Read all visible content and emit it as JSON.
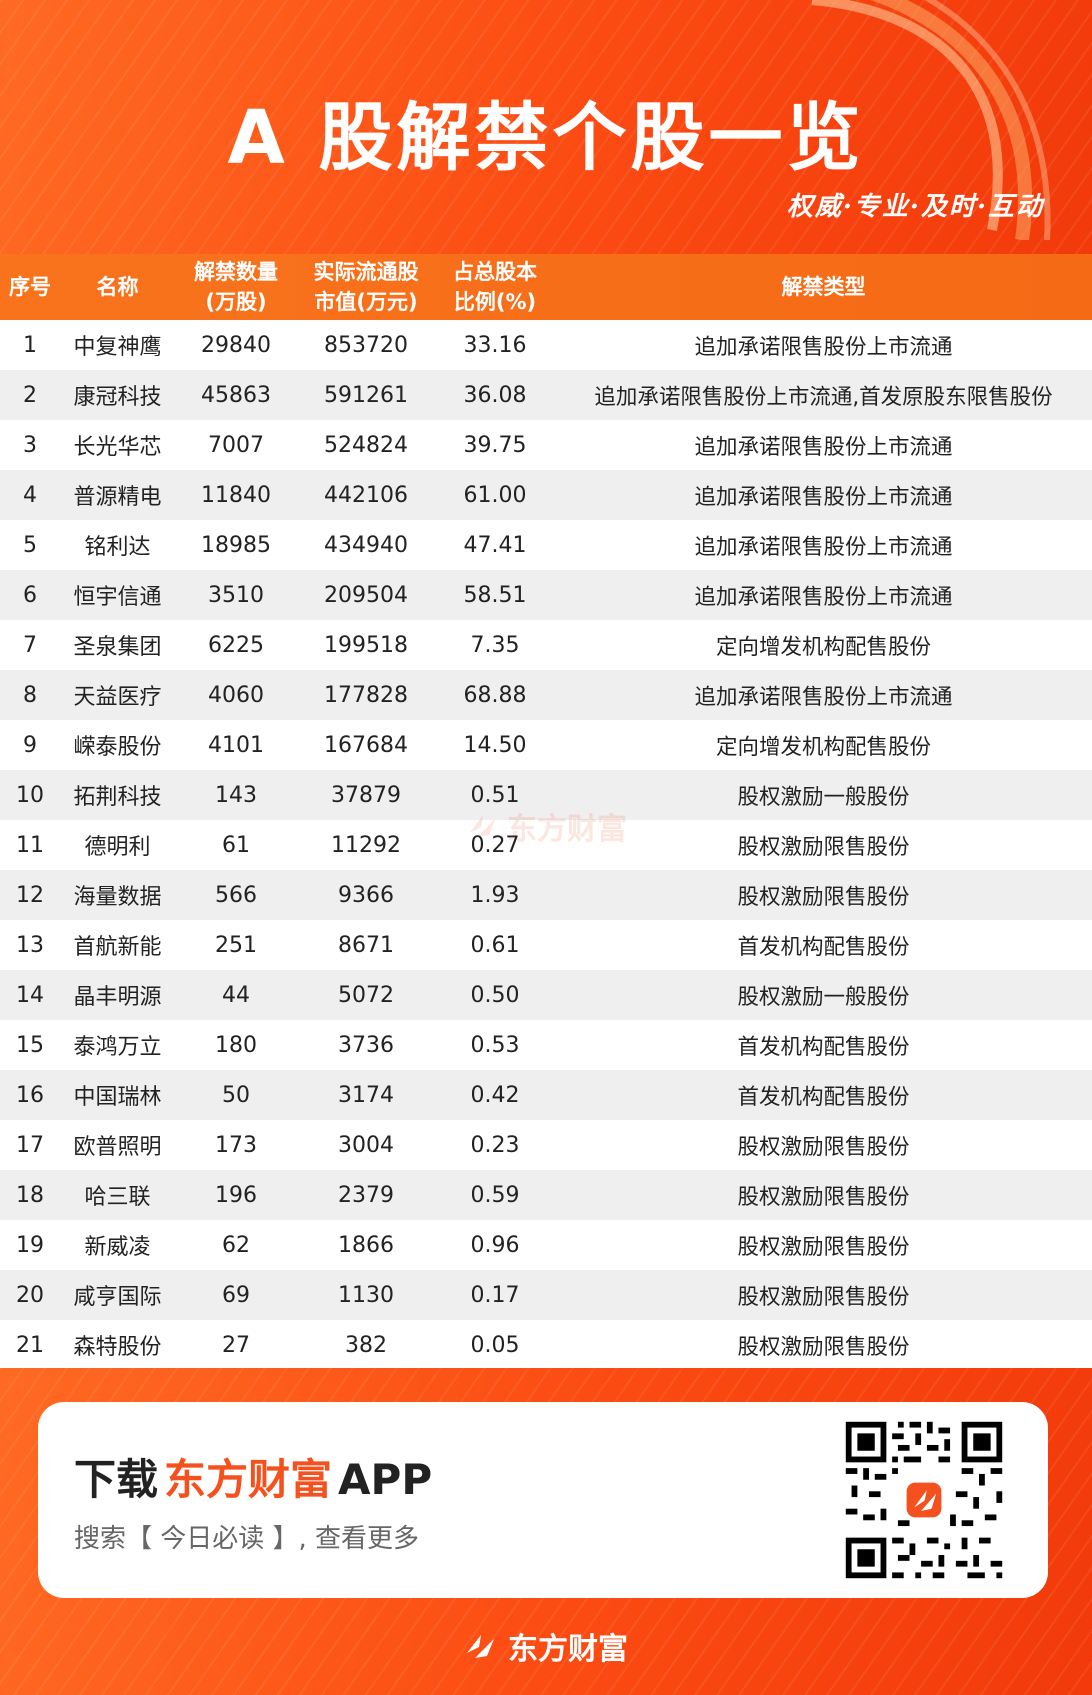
{
  "header": {
    "title": "A 股解禁个股一览",
    "slogan": "权威·专业·及时·互动"
  },
  "table": {
    "columns": {
      "idx": "序号",
      "name": "名称",
      "qty_1": "解禁数量",
      "qty_2": "(万股)",
      "mkt_1": "实际流通股",
      "mkt_2": "市值(万元)",
      "pct_1": "占总股本",
      "pct_2": "比例(%)",
      "type": "解禁类型"
    },
    "rows": [
      {
        "idx": "1",
        "name": "中复神鹰",
        "qty": "29840",
        "mkt": "853720",
        "pct": "33.16",
        "type": "追加承诺限售股份上市流通"
      },
      {
        "idx": "2",
        "name": "康冠科技",
        "qty": "45863",
        "mkt": "591261",
        "pct": "36.08",
        "type": "追加承诺限售股份上市流通,首发原股东限售股份"
      },
      {
        "idx": "3",
        "name": "长光华芯",
        "qty": "7007",
        "mkt": "524824",
        "pct": "39.75",
        "type": "追加承诺限售股份上市流通"
      },
      {
        "idx": "4",
        "name": "普源精电",
        "qty": "11840",
        "mkt": "442106",
        "pct": "61.00",
        "type": "追加承诺限售股份上市流通"
      },
      {
        "idx": "5",
        "name": "铭利达",
        "qty": "18985",
        "mkt": "434940",
        "pct": "47.41",
        "type": "追加承诺限售股份上市流通"
      },
      {
        "idx": "6",
        "name": "恒宇信通",
        "qty": "3510",
        "mkt": "209504",
        "pct": "58.51",
        "type": "追加承诺限售股份上市流通"
      },
      {
        "idx": "7",
        "name": "圣泉集团",
        "qty": "6225",
        "mkt": "199518",
        "pct": "7.35",
        "type": "定向增发机构配售股份"
      },
      {
        "idx": "8",
        "name": "天益医疗",
        "qty": "4060",
        "mkt": "177828",
        "pct": "68.88",
        "type": "追加承诺限售股份上市流通"
      },
      {
        "idx": "9",
        "name": "嵘泰股份",
        "qty": "4101",
        "mkt": "167684",
        "pct": "14.50",
        "type": "定向增发机构配售股份"
      },
      {
        "idx": "10",
        "name": "拓荆科技",
        "qty": "143",
        "mkt": "37879",
        "pct": "0.51",
        "type": "股权激励一般股份"
      },
      {
        "idx": "11",
        "name": "德明利",
        "qty": "61",
        "mkt": "11292",
        "pct": "0.27",
        "type": "股权激励限售股份"
      },
      {
        "idx": "12",
        "name": "海量数据",
        "qty": "566",
        "mkt": "9366",
        "pct": "1.93",
        "type": "股权激励限售股份"
      },
      {
        "idx": "13",
        "name": "首航新能",
        "qty": "251",
        "mkt": "8671",
        "pct": "0.61",
        "type": "首发机构配售股份"
      },
      {
        "idx": "14",
        "name": "晶丰明源",
        "qty": "44",
        "mkt": "5072",
        "pct": "0.50",
        "type": "股权激励一般股份"
      },
      {
        "idx": "15",
        "name": "泰鸿万立",
        "qty": "180",
        "mkt": "3736",
        "pct": "0.53",
        "type": "首发机构配售股份"
      },
      {
        "idx": "16",
        "name": "中国瑞林",
        "qty": "50",
        "mkt": "3174",
        "pct": "0.42",
        "type": "首发机构配售股份"
      },
      {
        "idx": "17",
        "name": "欧普照明",
        "qty": "173",
        "mkt": "3004",
        "pct": "0.23",
        "type": "股权激励限售股份"
      },
      {
        "idx": "18",
        "name": "哈三联",
        "qty": "196",
        "mkt": "2379",
        "pct": "0.59",
        "type": "股权激励限售股份"
      },
      {
        "idx": "19",
        "name": "新威凌",
        "qty": "62",
        "mkt": "1866",
        "pct": "0.96",
        "type": "股权激励限售股份"
      },
      {
        "idx": "20",
        "name": "咸亨国际",
        "qty": "69",
        "mkt": "1130",
        "pct": "0.17",
        "type": "股权激励限售股份"
      },
      {
        "idx": "21",
        "name": "森特股份",
        "qty": "27",
        "mkt": "382",
        "pct": "0.05",
        "type": "股权激励限售股份"
      }
    ]
  },
  "watermark": {
    "text": "东方财富",
    "icon": "eastmoney-logo-icon"
  },
  "footer": {
    "download_prefix": "下载",
    "download_brand": "东方财富",
    "download_suffix": "APP",
    "hint": "搜索【 今日必读 】, 查看更多",
    "qr_icon": "qr-code-icon",
    "logo_text": "东方财富",
    "logo_icon": "eastmoney-logo-icon"
  },
  "colors": {
    "brand_orange": "#f4511e",
    "header_orange": "#f9731d",
    "row_alt": "#efefef"
  }
}
